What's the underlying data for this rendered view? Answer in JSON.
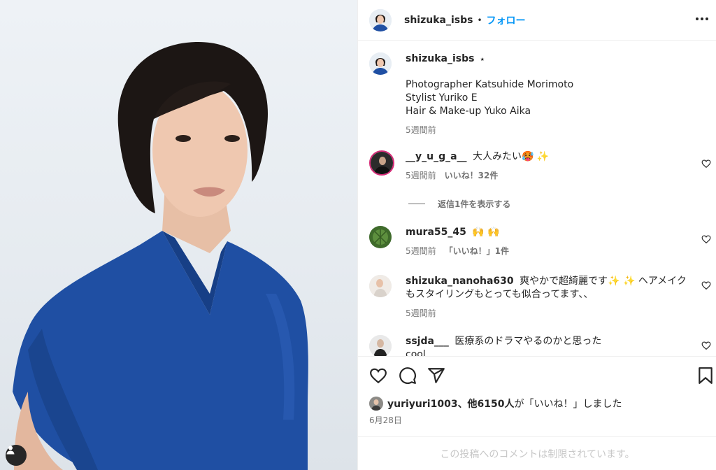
{
  "post": {
    "username": "shizuka_isbs",
    "follow_label": "フォロー",
    "header_separator": "•",
    "verified_mark": "⭑"
  },
  "caption": {
    "lines": [
      "Photographer Katsuhide Morimoto",
      "Stylist Yuriko E",
      "Hair & Make-up Yuko Aika"
    ],
    "time": "5週間前"
  },
  "comments": [
    {
      "username": "__y_u_g_a__",
      "text": "大人みたい🥵 ✨",
      "time": "5週間前",
      "likes": "いいね！32件"
    },
    {
      "username": "mura55_45",
      "text": "🙌 🙌",
      "time": "5週間前",
      "likes": "「いいね！」1件"
    },
    {
      "username": "shizuka_nanoha630",
      "text": "爽やかで超綺麗です✨ ✨ ヘアメイクもスタイリングもとっても似合ってます、、",
      "time": "5週間前"
    },
    {
      "username": "ssjda___",
      "text": "医療系のドラマやるのかと思った",
      "text2": "cool"
    }
  ],
  "replies": {
    "label": "返信1件を表示する"
  },
  "liked_by": {
    "user": "yuriyuri1003",
    "rest_bold": "、他6150人",
    "rest": "が「いいね！」しました"
  },
  "date": "6月28日",
  "restricted_text": "この投稿へのコメントは制限されています。",
  "icons": [
    "heart-icon",
    "comment-icon",
    "share-icon",
    "bookmark-icon",
    "more-icon",
    "user-tag-icon"
  ],
  "colors": {
    "accent": "#0095f6",
    "muted": "#737373",
    "shirt": "#1f4fa3"
  }
}
